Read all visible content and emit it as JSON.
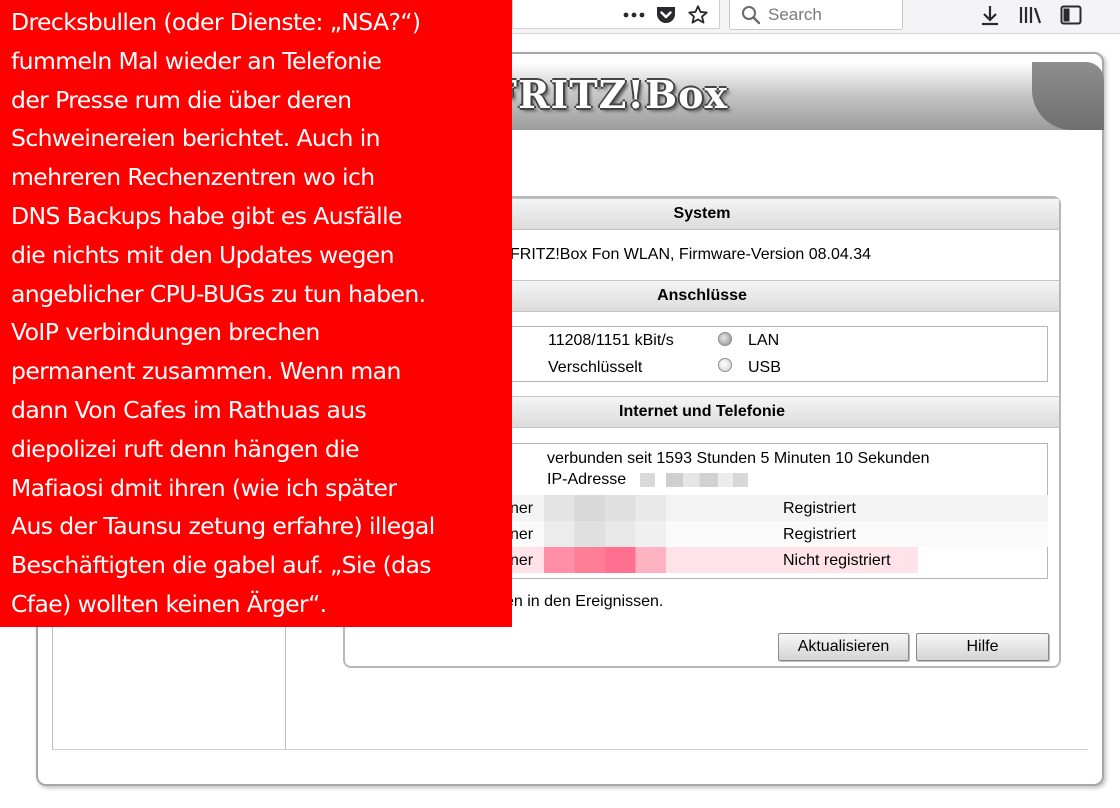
{
  "browser": {
    "search_placeholder": "Search",
    "icons": [
      "more-icon",
      "pocket-icon",
      "bookmark-star-icon",
      "search-icon",
      "download-icon",
      "library-icon",
      "sidebar-icon"
    ]
  },
  "page": {
    "logo": "FRITZ!Box",
    "system": {
      "heading": "System",
      "line": "FRITZ!Box Fon WLAN, Firmware-Version 08.04.34"
    },
    "connections": {
      "heading": "Anschlüsse",
      "rows": [
        {
          "value": "11208/1151 kBit/s",
          "led_label": "LAN"
        },
        {
          "value": "Verschlüsselt",
          "led_label": "USB"
        }
      ]
    },
    "internet": {
      "heading": "Internet und Telefonie",
      "connected": "verbunden seit 1593 Stunden 5 Minuten 10 Sekunden",
      "ip_label": "IP-Adresse",
      "phone_rows": [
        {
          "label_tail": "ner",
          "status": "Registriert"
        },
        {
          "label_tail": "ner",
          "status": "Registriert"
        },
        {
          "label_tail": "ner",
          "status": "Nicht registriert"
        }
      ],
      "events_text": "en in den Ereignissen."
    },
    "buttons": {
      "refresh": "Aktualisieren",
      "help": "Hilfe"
    }
  },
  "overlay": {
    "text": "Drecksbullen (oder Dienste: „NSA?“)\nfummeln Mal wieder an Telefonie\nder Presse rum die über deren\nSchweinereien berichtet. Auch in\nmehreren Rechenzentren wo ich\nDNS Backups habe gibt es Ausfälle\ndie nichts mit den Updates wegen\nangeblicher CPU-BUGs zu tun haben.\nVoIP verbindungen brechen\npermanent zusammen. Wenn man\ndann Von Cafes im Rathuas aus\ndiepolizei ruft denn hängen die\nMafiaosi dmit ihren (wie ich später\nAus der Taunsu zetung erfahre) illegal\nBeschäftigten die gabel auf. „Sie (das\nCfae) wollten keinen Ärger“.",
    "background": "#ff0000",
    "text_color": "#ffffff"
  },
  "colors": {
    "error_row": "#ffe3e8",
    "error_block": "#ff6f8f"
  }
}
